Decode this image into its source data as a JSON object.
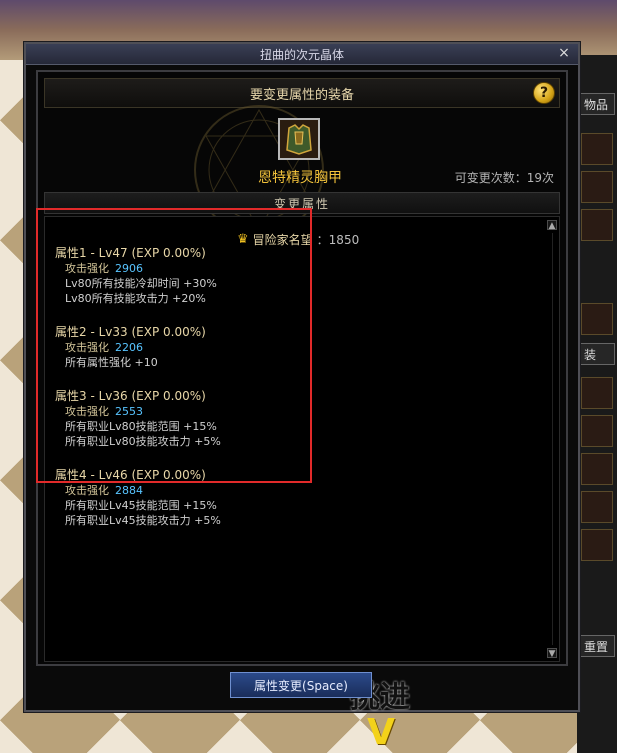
{
  "window": {
    "title": "扭曲的次元晶体",
    "close_glyph": "×"
  },
  "equipment": {
    "header": "要变更属性的装备",
    "item_name": "恩特精灵胸甲",
    "change_count": "可变更次数：19次"
  },
  "change_section": {
    "header": "变更属性"
  },
  "reputation": {
    "label": "冒险家名望",
    "value": "：1850"
  },
  "attributes": [
    {
      "title": "属性1 - Lv47 (EXP 0.00%)",
      "enhance_label": "攻击强化",
      "enhance_value": "2906",
      "lines": [
        "Lv80所有技能冷却时间 +30%",
        "Lv80所有技能攻击力 +20%"
      ]
    },
    {
      "title": "属性2 - Lv33 (EXP 0.00%)",
      "enhance_label": "攻击强化",
      "enhance_value": "2206",
      "lines": [
        "所有属性强化 +10"
      ]
    },
    {
      "title": "属性3 - Lv36 (EXP 0.00%)",
      "enhance_label": "攻击强化",
      "enhance_value": "2553",
      "lines": [
        "所有职业Lv80技能范围 +15%",
        "所有职业Lv80技能攻击力 +5%"
      ]
    },
    {
      "title": "属性4 - Lv46 (EXP 0.00%)",
      "enhance_label": "攻击强化",
      "enhance_value": "2884",
      "lines": [
        "所有职业Lv45技能范围 +15%",
        "所有职业Lv45技能攻击力 +5%"
      ]
    }
  ],
  "buttons": {
    "apply": "属性变更(Space)"
  },
  "side_panel": {
    "tab_top": "物品",
    "tab_mid": "装",
    "tab_bottom": "重置"
  },
  "background": {
    "word": "挑进"
  },
  "colors": {
    "highlight": "#e22a2a",
    "item_name": "#f2c23b",
    "value_blue": "#58c4ff"
  },
  "icons": {
    "help": "question-mark-icon",
    "reputation": "crown-icon",
    "scroll_up": "triangle-up",
    "scroll_down": "triangle-down"
  }
}
